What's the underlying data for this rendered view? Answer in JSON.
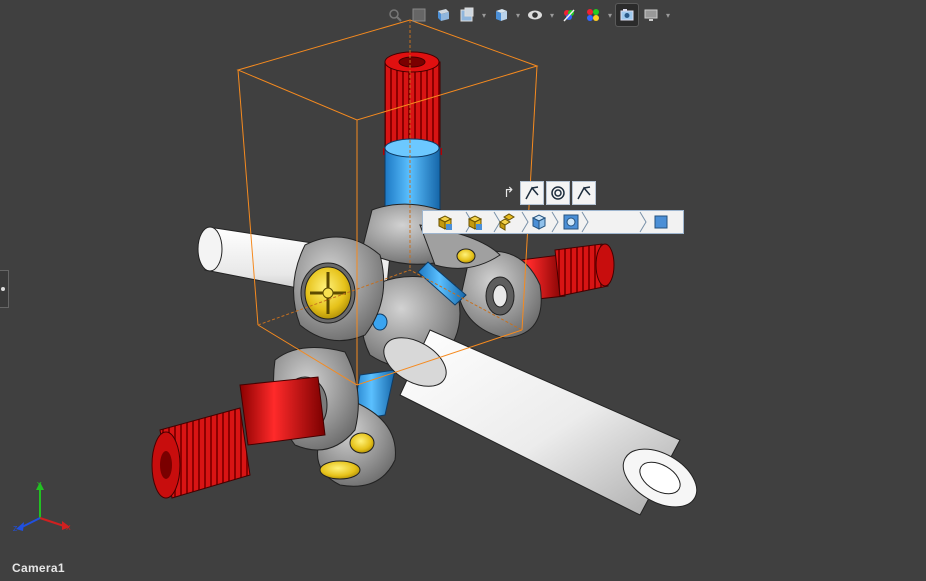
{
  "viewport": {
    "camera_label": "Camera1",
    "background_color": "#404040"
  },
  "heads_up_toolbar": {
    "buttons": [
      {
        "icon": "zoom-to-fit-icon"
      },
      {
        "icon": "zoom-to-area-icon"
      },
      {
        "icon": "previous-view-icon"
      },
      {
        "icon": "section-view-icon"
      },
      {
        "icon": "view-orientation-icon"
      },
      {
        "icon": "display-style-icon"
      },
      {
        "icon": "hide-show-items-icon"
      },
      {
        "icon": "edit-appearance-icon"
      },
      {
        "icon": "apply-scene-icon"
      },
      {
        "icon": "camera-view-icon"
      },
      {
        "icon": "display-monitor-icon"
      }
    ]
  },
  "context_toolbar": {
    "row1": [
      {
        "icon": "edge-icon"
      },
      {
        "icon": "concentric-icon"
      },
      {
        "icon": "edge-alt-icon"
      }
    ],
    "breadcrumbs": [
      {
        "icon": "assembly-icon"
      },
      {
        "icon": "subassembly-icon"
      },
      {
        "icon": "component-icon"
      },
      {
        "icon": "part-icon"
      },
      {
        "icon": "body-icon"
      },
      {
        "icon": "face-icon"
      }
    ],
    "hidden_label": ""
  },
  "colors": {
    "bounding_box": "#f58a1f",
    "shaft_white": "#f0f0f0",
    "spline_red": "#e01010",
    "pin_blue": "#2f9be8",
    "yoke_gray": "#8c8c8c",
    "cap_yellow": "#e6c21a"
  },
  "triad_axes": {
    "x": "X",
    "y": "Y",
    "z": "Z"
  }
}
